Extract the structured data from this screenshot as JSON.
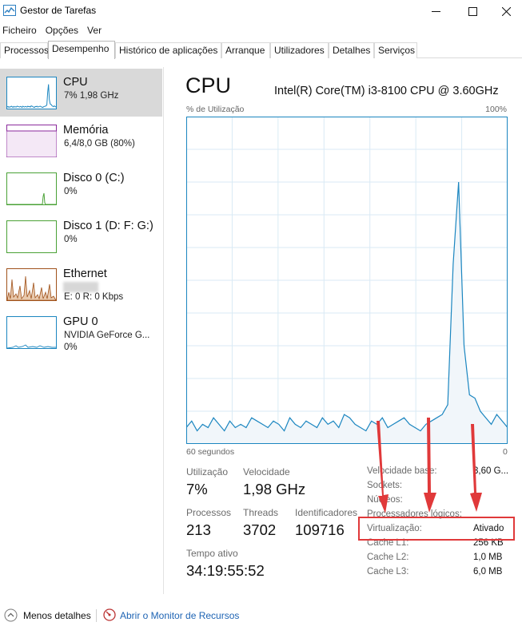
{
  "window": {
    "title": "Gestor de Tarefas"
  },
  "menu": [
    "Ficheiro",
    "Opções",
    "Ver"
  ],
  "tabs": [
    "Processos",
    "Desempenho",
    "Histórico de aplicações",
    "Arranque",
    "Utilizadores",
    "Detalhes",
    "Serviços"
  ],
  "active_tab": "Desempenho",
  "sidebar": {
    "items": [
      {
        "title": "CPU",
        "sub": "7% 1,98 GHz",
        "sub2": "",
        "color": "#1b86c0"
      },
      {
        "title": "Memória",
        "sub": "6,4/8,0 GB (80%)",
        "sub2": "",
        "color": "#8b2a9c"
      },
      {
        "title": "Disco 0 (C:)",
        "sub": "0%",
        "sub2": "",
        "color": "#4aa136"
      },
      {
        "title": "Disco 1 (D: F: G:)",
        "sub": "0%",
        "sub2": "",
        "color": "#4aa136"
      },
      {
        "title": "Ethernet",
        "sub": "",
        "sub2": "E: 0 R: 0 Kbps",
        "color": "#a0521b"
      },
      {
        "title": "GPU 0",
        "sub": "NVIDIA GeForce G...",
        "sub2": "0%",
        "color": "#1b86c0"
      }
    ]
  },
  "main": {
    "title": "CPU",
    "model": "Intel(R) Core(TM) i3-8100 CPU @ 3.60GHz",
    "util_label": "% de Utilização",
    "max_label": "100%",
    "time_label": "60 segundos",
    "min_label": "0",
    "graph_color": "#1b86c0",
    "graph_fill": "#f1f6fa",
    "grid_color": "#d9eaf5",
    "stats": [
      {
        "label": "Utilização",
        "value": "7%"
      },
      {
        "label": "Velocidade",
        "value": "1,98 GHz"
      },
      {
        "label": "Processos",
        "value": "213"
      },
      {
        "label": "Threads",
        "value": "3702"
      },
      {
        "label": "Identificadores",
        "value": "109716"
      },
      {
        "label": "Tempo ativo",
        "value": "34:19:55:52"
      }
    ],
    "specs": [
      {
        "label": "Velocidade base:",
        "value": "3,60 G..."
      },
      {
        "label": "Sockets:",
        "value": ""
      },
      {
        "label": "Núcleos:",
        "value": ""
      },
      {
        "label": "Processadores lógicos:",
        "value": ""
      },
      {
        "label": "Virtualização:",
        "value": "Ativado"
      },
      {
        "label": "Cache L1:",
        "value": "256 KB"
      },
      {
        "label": "Cache L2:",
        "value": "1,0 MB"
      },
      {
        "label": "Cache L3:",
        "value": "6,0 MB"
      }
    ],
    "highlight_color": "#e0393a"
  },
  "cpu_history": [
    5,
    7,
    4,
    6,
    5,
    8,
    6,
    4,
    7,
    5,
    6,
    5,
    8,
    7,
    6,
    5,
    7,
    6,
    4,
    8,
    6,
    5,
    7,
    6,
    5,
    8,
    6,
    7,
    5,
    9,
    8,
    6,
    5,
    4,
    7,
    6,
    8,
    5,
    6,
    7,
    8,
    6,
    5,
    4,
    6,
    7,
    8,
    9,
    12,
    55,
    80,
    30,
    15,
    14,
    10,
    8,
    6,
    9,
    7,
    5
  ],
  "footer": {
    "less": "Menos detalhes",
    "monitor": "Abrir o Monitor de Recursos"
  }
}
